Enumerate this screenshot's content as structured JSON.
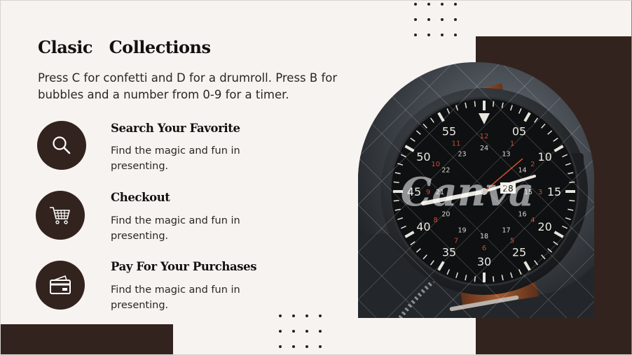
{
  "slide": {
    "title": "Clasic   Collections",
    "subtitle": "Press C for confetti and D for a drumroll. Press B for bubbles and a number from 0-9 for a timer."
  },
  "features": [
    {
      "title": "Search Your Favorite",
      "description": "Find the magic and fun in presenting.",
      "icon": "search-icon"
    },
    {
      "title": "Checkout",
      "description": "Find the magic and fun in presenting.",
      "icon": "shopping-cart-icon"
    },
    {
      "title": "Pay For Your Purchases",
      "description": "Find the magic and fun in presenting.",
      "icon": "credit-card-icon"
    }
  ],
  "watch": {
    "watermark": "Canva",
    "dial_numbers": [
      "05",
      "10",
      "15",
      "20",
      "25",
      "30",
      "35",
      "40",
      "45",
      "50",
      "55"
    ],
    "inner_numbers": [
      "24",
      "13",
      "14",
      "15",
      "16",
      "17",
      "18",
      "19",
      "20",
      "21",
      "22",
      "23"
    ],
    "red_numbers": [
      "12",
      "1",
      "2",
      "3",
      "4",
      "5",
      "6",
      "7",
      "8",
      "9",
      "10",
      "11"
    ],
    "date": "28"
  },
  "colors": {
    "background": "#f7f3f0",
    "accent_dark": "#33231e",
    "text": "#141010",
    "dial_red": "#c94d2e"
  }
}
